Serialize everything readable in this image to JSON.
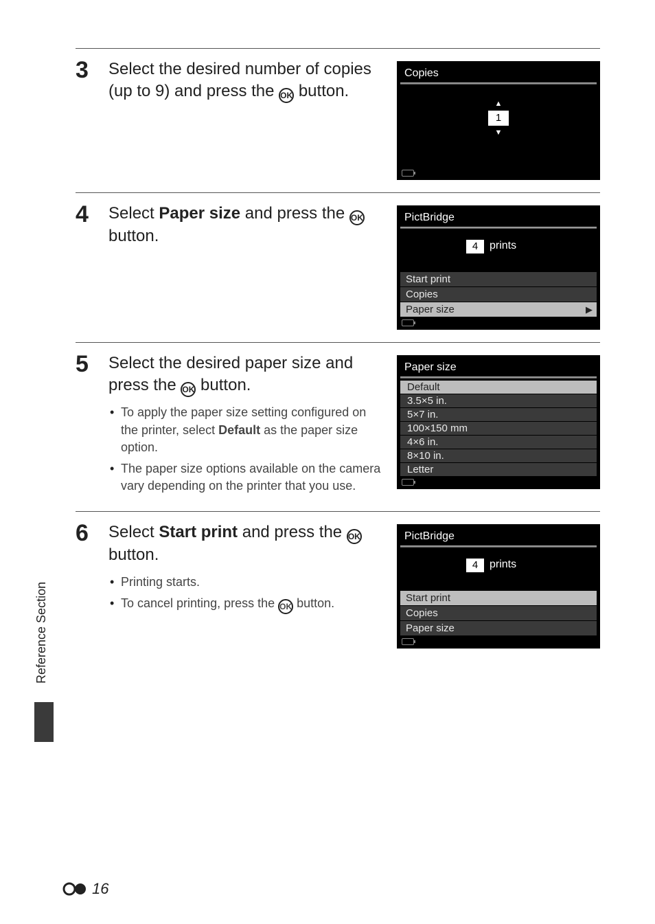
{
  "sideTab": "Reference Section",
  "pageNumber": "16",
  "steps": {
    "s3": {
      "num": "3",
      "title_a": "Select the desired number of copies (up to 9) and press the ",
      "title_b": " button.",
      "screen": {
        "title": "Copies",
        "value": "1"
      }
    },
    "s4": {
      "num": "4",
      "title_a": "Select ",
      "title_bold": "Paper size",
      "title_b": " and press the ",
      "title_c": " button.",
      "screen": {
        "title": "PictBridge",
        "prints_value": "4",
        "prints_label": "prints",
        "menu": {
          "start": "Start print",
          "copies": "Copies",
          "paper": "Paper size"
        }
      }
    },
    "s5": {
      "num": "5",
      "title_a": "Select the desired paper size and press the ",
      "title_b": " button.",
      "bullet1_a": "To apply the paper size setting configured on the printer, select ",
      "bullet1_bold": "Default",
      "bullet1_b": " as the paper size option.",
      "bullet2": "The paper size options available on the camera vary depending on the printer that you use.",
      "screen": {
        "title": "Paper size",
        "options": {
          "o0": "Default",
          "o1": "3.5×5 in.",
          "o2": "5×7 in.",
          "o3": "100×150 mm",
          "o4": "4×6 in.",
          "o5": "8×10 in.",
          "o6": "Letter"
        }
      }
    },
    "s6": {
      "num": "6",
      "title_a": "Select ",
      "title_bold": "Start print",
      "title_b": " and press the ",
      "title_c": " button.",
      "bullet1": "Printing starts.",
      "bullet2_a": "To cancel printing, press the ",
      "bullet2_b": " button.",
      "screen": {
        "title": "PictBridge",
        "prints_value": "4",
        "prints_label": "prints",
        "menu": {
          "start": "Start print",
          "copies": "Copies",
          "paper": "Paper size"
        }
      }
    }
  }
}
